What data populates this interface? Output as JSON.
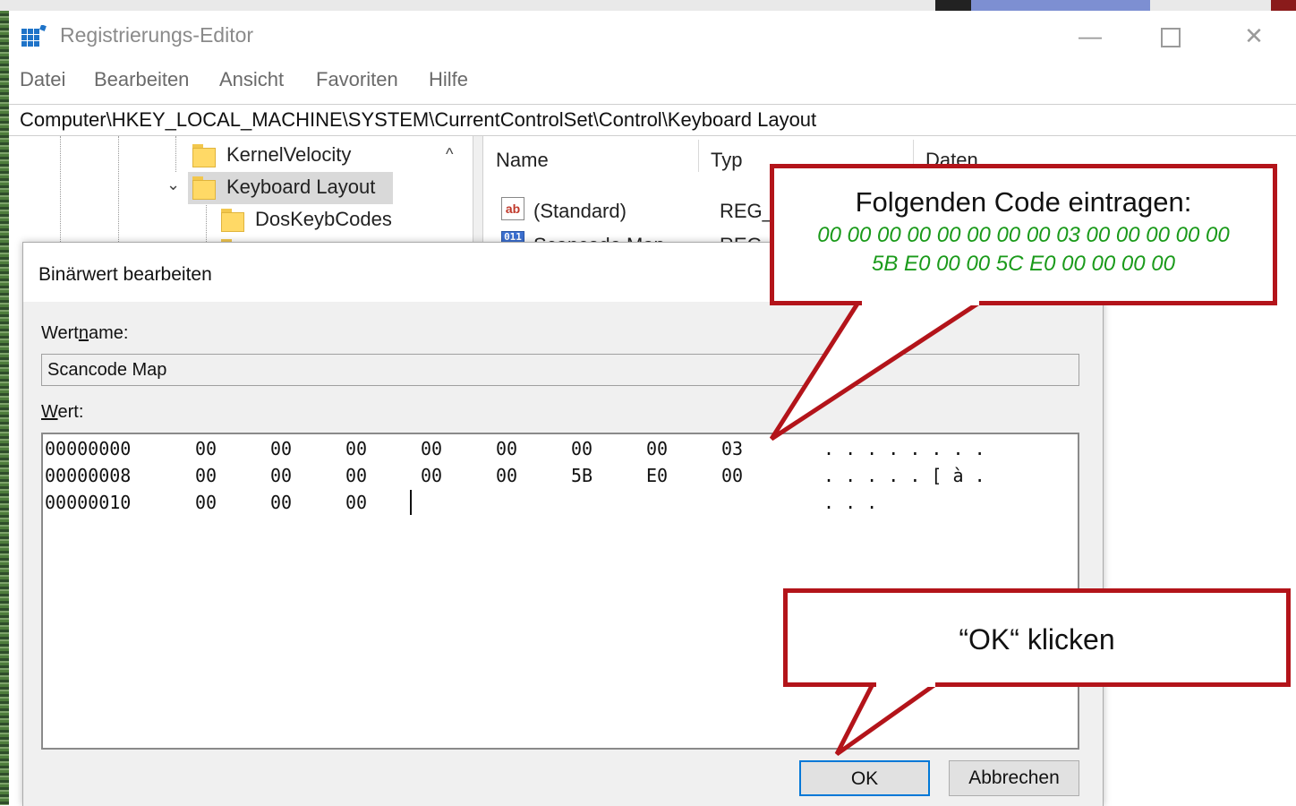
{
  "window": {
    "title": "Registrierungs-Editor",
    "menu": [
      "Datei",
      "Bearbeiten",
      "Ansicht",
      "Favoriten",
      "Hilfe"
    ],
    "address": "Computer\\HKEY_LOCAL_MACHINE\\SYSTEM\\CurrentControlSet\\Control\\Keyboard Layout"
  },
  "tree": {
    "items": [
      "KernelVelocity",
      "Keyboard Layout",
      "DosKeybCodes"
    ],
    "selected": "Keyboard Layout"
  },
  "list": {
    "columns": [
      "Name",
      "Typ",
      "Daten"
    ],
    "rows": [
      {
        "name": "(Standard)",
        "type": "REG_S",
        "icon": "string-value-icon"
      },
      {
        "name": "Scancode Map",
        "type": "REG_B",
        "icon": "binary-value-icon"
      }
    ]
  },
  "dialog": {
    "title": "Binärwert bearbeiten",
    "name_label_pre": "Wert",
    "name_label_u": "n",
    "name_label_post": "ame:",
    "name_value": "Scancode Map",
    "value_label_u": "W",
    "value_label_post": "ert:",
    "hex_rows": [
      {
        "offset": "00000000",
        "bytes": [
          "00",
          "00",
          "00",
          "00",
          "00",
          "00",
          "00",
          "03"
        ],
        "ascii": ". . . . . . . ."
      },
      {
        "offset": "00000008",
        "bytes": [
          "00",
          "00",
          "00",
          "00",
          "00",
          "5B",
          "E0",
          "00"
        ],
        "ascii": ". . . . . [ à ."
      },
      {
        "offset": "00000010",
        "bytes": [
          "00",
          "00",
          "00"
        ],
        "ascii": ". . ."
      }
    ],
    "ok_label": "OK",
    "cancel_label": "Abbrechen"
  },
  "callouts": {
    "code": {
      "title": "Folgenden Code eintragen:",
      "line1": "00 00 00 00 00 00 00 00 03 00 00 00 00 00",
      "line2": "5B E0 00 00 5C E0 00 00 00 00"
    },
    "ok": {
      "text": "“OK“ klicken"
    }
  },
  "colors": {
    "callout_border": "#b3141a",
    "code_text": "#1a9a1a",
    "ok_button_focus": "#0078d7"
  }
}
